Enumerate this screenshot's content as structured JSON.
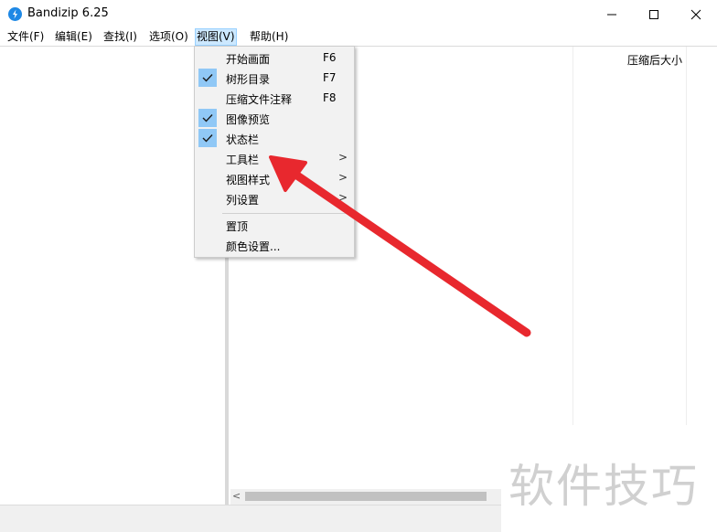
{
  "window": {
    "title": "Bandizip 6.25",
    "icon": "bandizip-logo-icon"
  },
  "menubar": [
    {
      "label": "文件(F)"
    },
    {
      "label": "编辑(E)"
    },
    {
      "label": "查找(I)"
    },
    {
      "label": "选项(O)"
    },
    {
      "label": "视图(V)",
      "active": true
    },
    {
      "label": "帮助(H)"
    }
  ],
  "view_menu": {
    "items": [
      {
        "label": "开始画面",
        "shortcut": "F6",
        "checked": false
      },
      {
        "label": "树形目录",
        "shortcut": "F7",
        "checked": true
      },
      {
        "label": "压缩文件注释",
        "shortcut": "F8",
        "checked": false
      },
      {
        "label": "图像预览",
        "shortcut": "",
        "checked": true
      },
      {
        "label": "状态栏",
        "shortcut": "",
        "checked": true
      },
      {
        "label": "工具栏",
        "submenu": true
      },
      {
        "label": "视图样式",
        "submenu": true
      },
      {
        "label": "列设置",
        "submenu": true
      },
      {
        "label": "置顶"
      },
      {
        "label": "颜色设置..."
      }
    ],
    "submenu_arrow": ">"
  },
  "file_list": {
    "columns": [
      "压缩后大小"
    ]
  },
  "watermark": "软件技巧",
  "colors": {
    "accent": "#1e88e5",
    "check_bg": "#90c8f6",
    "menu_active_bg": "#cce8ff",
    "annotation_arrow": "#e8282e"
  }
}
